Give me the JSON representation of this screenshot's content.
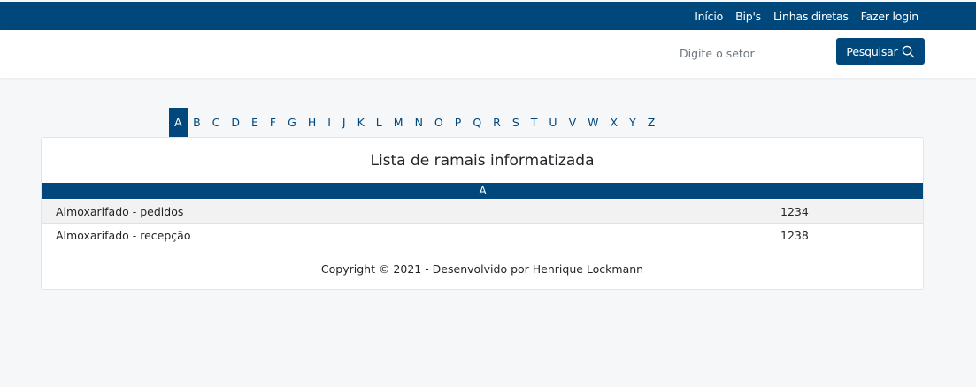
{
  "topnav": {
    "items": [
      "Início",
      "Bip's",
      "Linhas diretas",
      "Fazer login"
    ]
  },
  "search": {
    "placeholder": "Digite o setor",
    "value": "",
    "button_label": "Pesquisar",
    "button_icon": "search-icon"
  },
  "alphabet": {
    "letters": [
      "A",
      "B",
      "C",
      "D",
      "E",
      "F",
      "G",
      "H",
      "I",
      "J",
      "K",
      "L",
      "M",
      "N",
      "O",
      "P",
      "Q",
      "R",
      "S",
      "T",
      "U",
      "V",
      "W",
      "X",
      "Y",
      "Z"
    ],
    "active": "A"
  },
  "card": {
    "title": "Lista de ramais informatizada",
    "section": "A",
    "rows": [
      {
        "name": "Almoxarifado - pedidos",
        "ext": "1234"
      },
      {
        "name": "Almoxarifado - recepção",
        "ext": "1238"
      }
    ],
    "footer": "Copyright © 2021 - Desenvolvido por Henrique Lockmann"
  },
  "colors": {
    "brand": "#00477c",
    "row_alt": "#f2f2f2",
    "page_bg": "#f6f7f9"
  }
}
